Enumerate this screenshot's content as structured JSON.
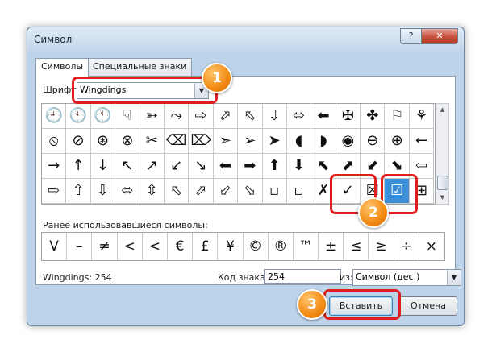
{
  "window": {
    "title": "Символ",
    "help_label": "?",
    "close_label": "✕"
  },
  "tabs": [
    {
      "label": "Символы",
      "active": true
    },
    {
      "label": "Специальные знаки",
      "active": false
    }
  ],
  "font": {
    "label": "Шрифт:",
    "value": "Wingdings"
  },
  "symbol_grid": {
    "rows": [
      [
        "🕘",
        "🕙",
        "🕚",
        "☟",
        "➳",
        "⤳",
        "⇨",
        "⬀",
        "⬁",
        "⇩",
        "⬄",
        "⬅",
        "✠",
        "✤",
        "⚐",
        "⚘"
      ],
      [
        "⦸",
        "⊘",
        "⊛",
        "⊗",
        "✂",
        "⌫",
        "⌦",
        "➣",
        "➢",
        "➤",
        "◖",
        "◗",
        "◉",
        "⊖",
        "⊕",
        "←"
      ],
      [
        "→",
        "↑",
        "↓",
        "↖",
        "↗",
        "↙",
        "↘",
        "⬅",
        "➡",
        "⬆",
        "⬇",
        "⬉",
        "⬈",
        "⬋",
        "⬊",
        "⇦"
      ],
      [
        "⇨",
        "⇧",
        "⇩",
        "⬄",
        "⇳",
        "⬁",
        "⬀",
        "⬃",
        "⬂",
        "▫",
        "▫",
        "✗",
        "✓",
        "☒",
        "☑",
        "⊞"
      ]
    ],
    "selected_row": 3,
    "selected_col": 14
  },
  "recent": {
    "label": "Ранее использовавшиеся символы:",
    "symbols": [
      "V",
      "–",
      "≠",
      "<",
      "<",
      "€",
      "£",
      "¥",
      "©",
      "®",
      "™",
      "±",
      "≤",
      "≥",
      "÷",
      "×"
    ]
  },
  "status": {
    "name": "Wingdings: 254",
    "code_label": "Код знака:",
    "code_value": "254",
    "from_label": "из:",
    "from_value": "Символ (дес.)"
  },
  "buttons": {
    "insert": "Вставить",
    "cancel": "Отмена"
  },
  "callouts": [
    "1",
    "2",
    "3"
  ],
  "colors": {
    "highlight": "#e01e1e",
    "badge": "#f28a13",
    "selection": "#3b8fd8"
  }
}
